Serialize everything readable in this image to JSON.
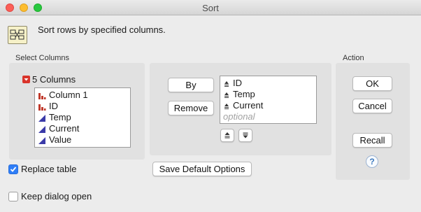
{
  "window": {
    "title": "Sort"
  },
  "header": {
    "text": "Sort rows by specified columns.",
    "icon": "sort-icon"
  },
  "select_columns": {
    "label": "Select Columns",
    "count_label": "5 Columns",
    "columns": [
      {
        "name": "Column 1",
        "type": "nominal"
      },
      {
        "name": "ID",
        "type": "nominal"
      },
      {
        "name": "Temp",
        "type": "continuous"
      },
      {
        "name": "Current",
        "type": "continuous"
      },
      {
        "name": "Value",
        "type": "continuous"
      }
    ]
  },
  "sort_by": {
    "by_button": "By",
    "remove_button": "Remove",
    "items": [
      "ID",
      "Temp",
      "Current"
    ],
    "placeholder": "optional"
  },
  "action": {
    "label": "Action",
    "ok": "OK",
    "cancel": "Cancel",
    "recall": "Recall",
    "help": "?"
  },
  "options": {
    "replace_table": {
      "label": "Replace table",
      "checked": true
    },
    "keep_open": {
      "label": "Keep dialog open",
      "checked": false
    },
    "save_defaults": "Save Default Options"
  },
  "colors": {
    "accent": "#2f7ef7",
    "nominal": "#c0392b",
    "continuous": "#3a3aa8"
  }
}
